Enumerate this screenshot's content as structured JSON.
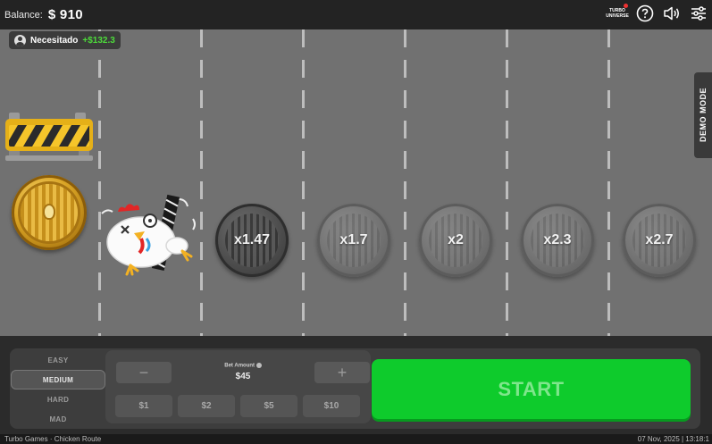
{
  "header": {
    "balance_label": "Balance:",
    "balance_value": "$ 910",
    "brand_line1": "TURBO",
    "brand_line2": "UNIVERSE"
  },
  "player": {
    "name": "Necesitado",
    "win": "+$132.3"
  },
  "demo_mode_label": "DEMO MODE",
  "lanes": {
    "multipliers": [
      "x1.47",
      "x1.7",
      "x2",
      "x2.3",
      "x2.7"
    ]
  },
  "difficulty": {
    "options": [
      "EASY",
      "MEDIUM",
      "HARD",
      "MAD"
    ],
    "selected": "MEDIUM"
  },
  "bet": {
    "minus": "−",
    "plus": "+",
    "label": "Bet Amount",
    "value": "$45",
    "chips": [
      "$1",
      "$2",
      "$5",
      "$10"
    ]
  },
  "start_label": "START",
  "footer": {
    "left": "Turbo Games · Chicken Route",
    "right": "07 Nov, 2025 | 13:18:1"
  },
  "colors": {
    "start": "#0ecb2c",
    "win": "#4ddc3a",
    "road": "#717171"
  }
}
